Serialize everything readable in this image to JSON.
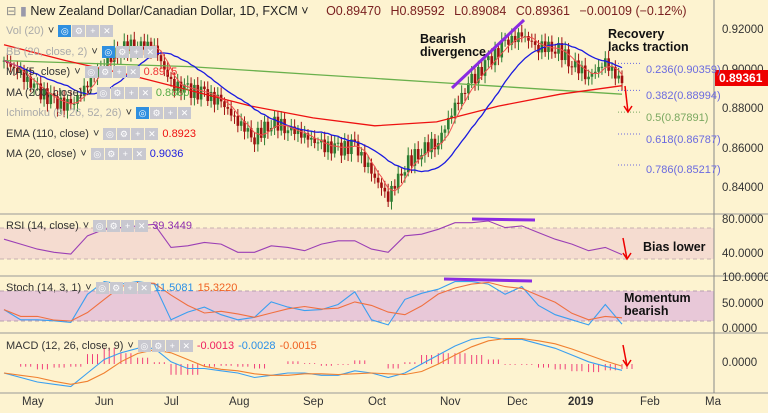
{
  "header": {
    "symbol_title": "New Zealand Dollar/Canadian Dollar, 1D, FXCM",
    "open": "O0.89470",
    "high": "H0.89592",
    "low": "L0.89084",
    "close": "C0.89361",
    "change": "−0.00109 (−0.12%)"
  },
  "legend": [
    {
      "label": "Vol (20)",
      "value": "",
      "color": "#aaaaaa",
      "faded": true
    },
    {
      "label": "BB (20, close, 2)",
      "value": "",
      "color": "#aaaaaa",
      "faded": true
    },
    {
      "label": "MA (5, close)",
      "value": "0.8975",
      "color": "#ee3333"
    },
    {
      "label": "MA (200, close)",
      "value": "0.8880",
      "color": "#55aa44"
    },
    {
      "label": "Ichimoku (9, 26, 52, 26)",
      "value": "",
      "color": "#aaaaaa",
      "faded": true
    },
    {
      "label": "EMA (110, close)",
      "value": "0.8923",
      "color": "#ee1111"
    },
    {
      "label": "MA (20, close)",
      "value": "0.9036",
      "color": "#1a1ae0"
    }
  ],
  "indicators": {
    "rsi": {
      "label": "RSI (14, close)",
      "value": "39.3449"
    },
    "stoch": {
      "label": "Stoch (14, 3, 1)",
      "k": "11.5081",
      "d": "15.3220"
    },
    "macd": {
      "label": "MACD (12, 26, close, 9)",
      "hist": "-0.0013",
      "macd": "-0.0028",
      "signal": "-0.0015"
    }
  },
  "price_axis": [
    "0.92000",
    "0.90000",
    "0.88000",
    "0.86000",
    "0.84000"
  ],
  "current_price": "0.89361",
  "rsi_axis": [
    "80.0000",
    "40.0000"
  ],
  "stoch_axis": [
    "100.0000",
    "50.0000",
    "0.0000"
  ],
  "macd_axis": [
    "0.0000"
  ],
  "months": [
    "May",
    "Jun",
    "Jul",
    "Aug",
    "Sep",
    "Oct",
    "Nov",
    "Dec",
    "2019",
    "Feb",
    "Ma"
  ],
  "fib": [
    {
      "label": "0.236(0.90359)",
      "color": "#6a6ae0"
    },
    {
      "label": "0.382(0.88994)",
      "color": "#6a6ae0"
    },
    {
      "label": "0.5(0.87891)",
      "color": "#7aa860"
    },
    {
      "label": "0.618(0.86787)",
      "color": "#6a6ae0"
    },
    {
      "label": "0.786(0.85217)",
      "color": "#6a6ae0"
    }
  ],
  "annotations": {
    "divergence": "Bearish divergence",
    "recovery": "Recovery lacks traction",
    "bias": "Bias lower",
    "momentum": "Momentum bearish"
  },
  "chart_data": {
    "type": "line",
    "title": "New Zealand Dollar/Canadian Dollar, 1D, FXCM",
    "x_unit": "week (from late Apr 2018)",
    "close": [
      0.905,
      0.898,
      0.89,
      0.884,
      0.882,
      0.893,
      0.905,
      0.911,
      0.913,
      0.912,
      0.893,
      0.89,
      0.888,
      0.884,
      0.874,
      0.866,
      0.874,
      0.871,
      0.867,
      0.862,
      0.86,
      0.862,
      0.848,
      0.836,
      0.852,
      0.86,
      0.864,
      0.882,
      0.895,
      0.904,
      0.914,
      0.918,
      0.912,
      0.912,
      0.904,
      0.897,
      0.904,
      0.8936
    ],
    "ema110": [
      0.913,
      0.905,
      0.898,
      0.89,
      0.882,
      0.876,
      0.872,
      0.874,
      0.882,
      0.888,
      0.8923
    ],
    "ma200": [
      0.905,
      0.904,
      0.903,
      0.902,
      0.9,
      0.898,
      0.896,
      0.894,
      0.892,
      0.89,
      0.888
    ],
    "rsi": [
      58,
      52,
      46,
      42,
      40,
      62,
      70,
      72,
      74,
      76,
      48,
      50,
      54,
      52,
      42,
      42,
      50,
      48,
      44,
      52,
      56,
      56,
      46,
      42,
      62,
      64,
      70,
      78,
      78,
      80,
      72,
      74,
      66,
      58,
      52,
      44,
      48,
      39.3
    ],
    "stoch": [
      40,
      20,
      20,
      18,
      15,
      70,
      95,
      90,
      95,
      90,
      20,
      35,
      45,
      30,
      20,
      25,
      55,
      45,
      38,
      40,
      50,
      75,
      20,
      10,
      60,
      72,
      80,
      95,
      95,
      90,
      70,
      85,
      48,
      30,
      20,
      10,
      50,
      11.5
    ],
    "macd": [
      -0.004,
      -0.006,
      -0.008,
      -0.009,
      -0.01,
      -0.004,
      0.002,
      0.005,
      0.007,
      0.007,
      0.001,
      -0.002,
      -0.002,
      -0.003,
      -0.004,
      -0.006,
      -0.005,
      -0.004,
      -0.004,
      -0.005,
      -0.005,
      -0.003,
      -0.004,
      -0.006,
      -0.004,
      0.0,
      0.004,
      0.008,
      0.011,
      0.012,
      0.011,
      0.011,
      0.009,
      0.007,
      0.004,
      0.001,
      -0.001,
      -0.0028
    ],
    "price_ylim": [
      0.83,
      0.925
    ],
    "rsi_ylim": [
      20,
      90
    ],
    "stoch_ylim": [
      0,
      100
    ]
  }
}
